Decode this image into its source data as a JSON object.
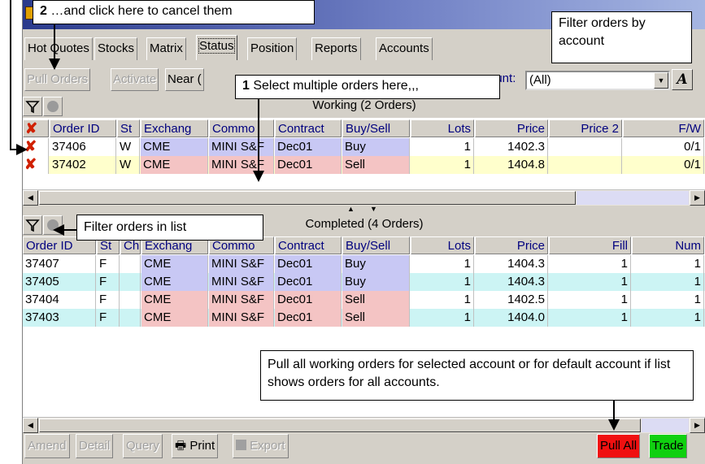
{
  "tabs": [
    "Hot Quotes",
    "Stocks",
    "Matrix",
    "Status",
    "Position",
    "Reports",
    "Accounts"
  ],
  "active_tab": "Status",
  "toolbar": {
    "pull_orders": "Pull Orders",
    "activate": "Activate",
    "near": "Near (",
    "account_label": "ount:",
    "account_value": "(All)",
    "font_button": "A"
  },
  "working": {
    "title": "Working (2 Orders)",
    "columns": [
      "Order ID",
      "St",
      "Exchang",
      "Commo",
      "Contract",
      "Buy/Sell",
      "Lots",
      "Price",
      "Price 2",
      "F/W"
    ],
    "rows": [
      {
        "id": "37406",
        "st": "W",
        "exch": "CME",
        "comm": "MINI S&F",
        "contract": "Dec01",
        "side": "Buy",
        "lots": "1",
        "price": "1402.3",
        "price2": "",
        "fw": "0/1"
      },
      {
        "id": "37402",
        "st": "W",
        "exch": "CME",
        "comm": "MINI S&F",
        "contract": "Dec01",
        "side": "Sell",
        "lots": "1",
        "price": "1404.8",
        "price2": "",
        "fw": "0/1"
      }
    ]
  },
  "completed": {
    "title": "Completed (4 Orders)",
    "columns": [
      "Order ID",
      "St",
      "Chk",
      "Exchang",
      "Commo",
      "Contract",
      "Buy/Sell",
      "Lots",
      "Price",
      "Fill",
      "Num"
    ],
    "rows": [
      {
        "id": "37407",
        "st": "F",
        "chk": "",
        "exch": "CME",
        "comm": "MINI S&F",
        "contract": "Dec01",
        "side": "Buy",
        "lots": "1",
        "price": "1404.3",
        "fill": "1",
        "num": "1"
      },
      {
        "id": "37405",
        "st": "F",
        "chk": "",
        "exch": "CME",
        "comm": "MINI S&F",
        "contract": "Dec01",
        "side": "Buy",
        "lots": "1",
        "price": "1404.3",
        "fill": "1",
        "num": "1"
      },
      {
        "id": "37404",
        "st": "F",
        "chk": "",
        "exch": "CME",
        "comm": "MINI S&F",
        "contract": "Dec01",
        "side": "Sell",
        "lots": "1",
        "price": "1402.5",
        "fill": "1",
        "num": "1"
      },
      {
        "id": "37403",
        "st": "F",
        "chk": "",
        "exch": "CME",
        "comm": "MINI S&F",
        "contract": "Dec01",
        "side": "Sell",
        "lots": "1",
        "price": "1404.0",
        "fill": "1",
        "num": "1"
      }
    ]
  },
  "bottom": {
    "amend": "Amend",
    "detail": "Detail",
    "query": "Query",
    "print": "Print",
    "export": "Export",
    "pull_all": "Pull All",
    "trade": "Trade"
  },
  "callouts": {
    "step2_num": "2",
    "step2_text": " …and click here to cancel them",
    "step1_num": "1",
    "step1_text": " Select multiple orders here,,,",
    "filter_account": "Filter orders by account",
    "filter_list": "Filter orders in list",
    "pull_all_note": "Pull all working orders for selected account or for default account if list shows orders for all accounts."
  },
  "colors": {
    "buy_bg": "#c8c8f4",
    "sell_bg": "#f4c4c4",
    "row_yellow": "#ffffcc",
    "row_cyan": "#ccf4f4",
    "pull_all_bg": "#f01010",
    "trade_bg": "#10d010"
  }
}
